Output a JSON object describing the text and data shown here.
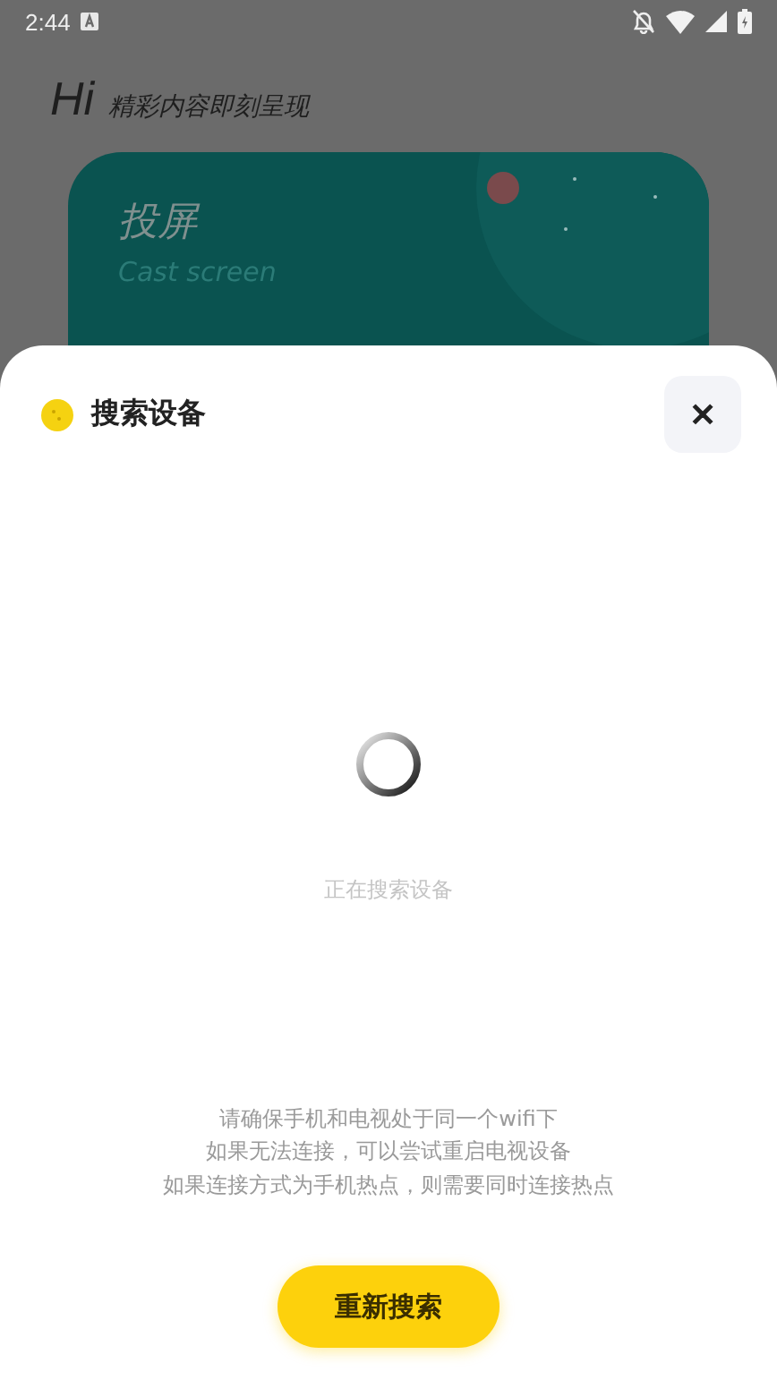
{
  "status_bar": {
    "time": "2:44"
  },
  "header": {
    "greeting": "Hi",
    "slogan": "精彩内容即刻呈现"
  },
  "card": {
    "title": "投屏",
    "subtitle": "Cast screen"
  },
  "sheet": {
    "title": "搜索设备",
    "close": "✕",
    "status": "正在搜索设备",
    "tips": [
      "请确保手机和电视处于同一个wifi下",
      "如果无法连接，可以尝试重启电视设备",
      "如果连接方式为手机热点，则需要同时连接热点"
    ],
    "button": "重新搜索"
  }
}
